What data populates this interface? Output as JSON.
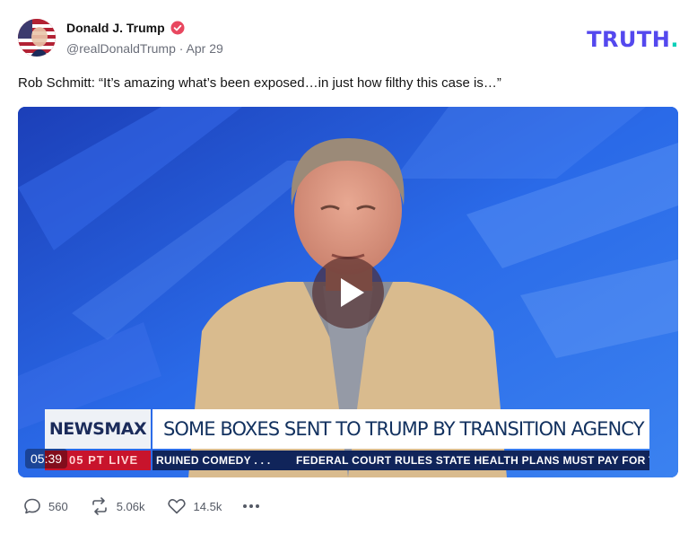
{
  "author": {
    "name": "Donald J. Trump",
    "handle": "@realDonaldTrump",
    "date": "Apr 29",
    "verified": true,
    "avatar_icon": "flag-portrait-avatar"
  },
  "brand": {
    "logo_main": "TRUTH",
    "logo_dot": ".",
    "color": "#5448ee",
    "dot_color": "#0ad0b8"
  },
  "post": {
    "text": "Rob Schmitt: “It’s amazing what’s been exposed…in just how filthy this case is…”"
  },
  "video": {
    "duration": "05:39",
    "network": "NEWSMAX",
    "headline": "SOME BOXES SENT TO TRUMP BY TRANSITION AGENCY",
    "ticker_left": "05 PT  LIVE",
    "ticker_items": [
      "RUINED COMEDY . . .",
      "FEDERAL COURT RULES STATE HEALTH PLANS MUST PAY FOR TI"
    ]
  },
  "actions": {
    "replies": "560",
    "retruths": "5.06k",
    "likes": "14.5k"
  }
}
